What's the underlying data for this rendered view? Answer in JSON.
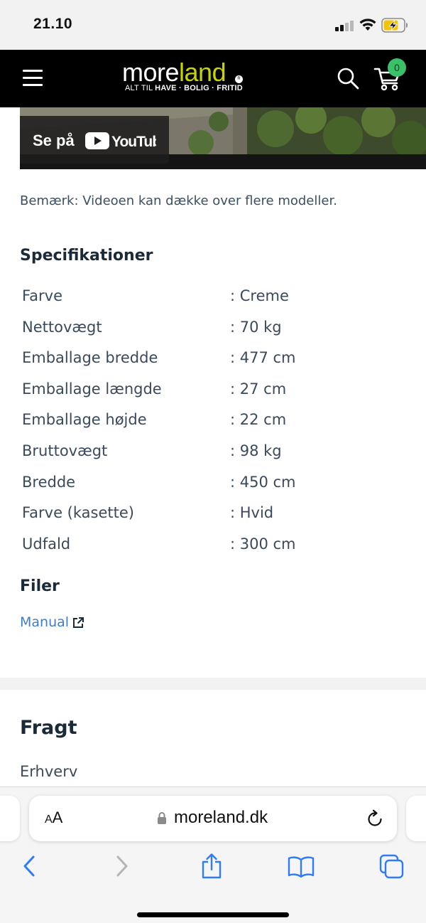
{
  "status_bar": {
    "time": "21.10",
    "signal_icon": "cellular-signal-icon",
    "wifi_icon": "wifi-icon",
    "battery_icon": "battery-charging-icon",
    "battery_color": "#f5c400"
  },
  "header": {
    "logo_part1": "more",
    "logo_part2": "land",
    "logo_registered": "R",
    "tagline_prefix": "ALT TIL ",
    "tagline_bold": "HAVE · BOLIG · FRITID",
    "cart_count": "0",
    "brand_green": "#c6d400",
    "badge_color": "#3bc06a"
  },
  "video": {
    "watch_label": "Se på",
    "platform": "YouTube"
  },
  "note": "Bemærk: Videoen kan dække over flere modeller.",
  "specs": {
    "title": "Specifikationer",
    "rows": [
      {
        "key": "Farve",
        "value": ": Creme"
      },
      {
        "key": "Nettovægt",
        "value": ": 70 kg"
      },
      {
        "key": "Emballage bredde",
        "value": ": 477 cm"
      },
      {
        "key": "Emballage længde",
        "value": ": 27 cm"
      },
      {
        "key": "Emballage højde",
        "value": ": 22 cm"
      },
      {
        "key": "Bruttovægt",
        "value": ": 98 kg"
      },
      {
        "key": "Bredde",
        "value": ": 450 cm"
      },
      {
        "key": "Farve (kasette)",
        "value": ": Hvid"
      },
      {
        "key": "Udfald",
        "value": ": 300 cm"
      }
    ]
  },
  "files": {
    "title": "Filer",
    "manual_label": "Manual"
  },
  "freight": {
    "title": "Fragt",
    "first_item": "Erhverv"
  },
  "browser": {
    "text_size_label_small": "A",
    "text_size_label_big": "A",
    "url": "moreland.dk",
    "link_color": "#3d7fc6",
    "toolbar_icons": [
      "back-icon",
      "forward-icon",
      "share-icon",
      "bookmarks-icon",
      "tabs-icon"
    ]
  }
}
